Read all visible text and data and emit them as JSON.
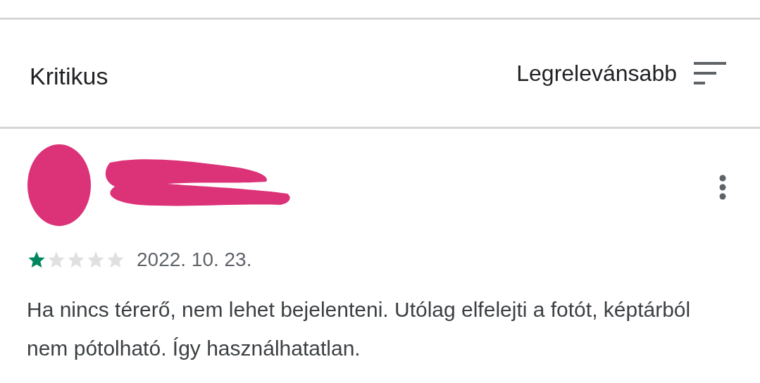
{
  "filter": {
    "label": "Kritikus"
  },
  "sort": {
    "label": "Legrelevánsabb"
  },
  "reviews": [
    {
      "stars": 1,
      "date": "2022. 10. 23.",
      "text": "Ha nincs térerő, nem lehet bejelenteni. Utólag elfelejti a fotót, képtárból nem pótolható. Így használhatatlan."
    }
  ]
}
